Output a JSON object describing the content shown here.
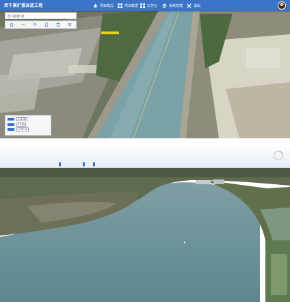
{
  "app": {
    "title": "西干渠扩整改造工程",
    "colors": {
      "navbar": "#3b73c6",
      "water": "#6f9fa8"
    }
  },
  "nav": {
    "items": [
      {
        "label": "项目概况",
        "icon": "star-icon"
      },
      {
        "label": "项目数据",
        "icon": "grid-icon"
      },
      {
        "label": "工作台",
        "icon": "grid-icon"
      },
      {
        "label": "系统管理",
        "icon": "gear-icon"
      },
      {
        "label": "退出",
        "icon": "tools-icon"
      }
    ]
  },
  "search": {
    "placeholder": "西干渠改扩建"
  },
  "toolbar": {
    "tools": [
      "home-icon",
      "measure-icon",
      "layer-icon",
      "save-icon",
      "delete-icon",
      "locate-icon"
    ]
  },
  "coordinates": {
    "rows": [
      {
        "value": "110.45"
      },
      {
        "value": "37.60"
      },
      {
        "value": "1235.00"
      }
    ]
  },
  "views": {
    "top": {
      "description_hidden": true
    },
    "bottom": {
      "loading": true
    }
  }
}
